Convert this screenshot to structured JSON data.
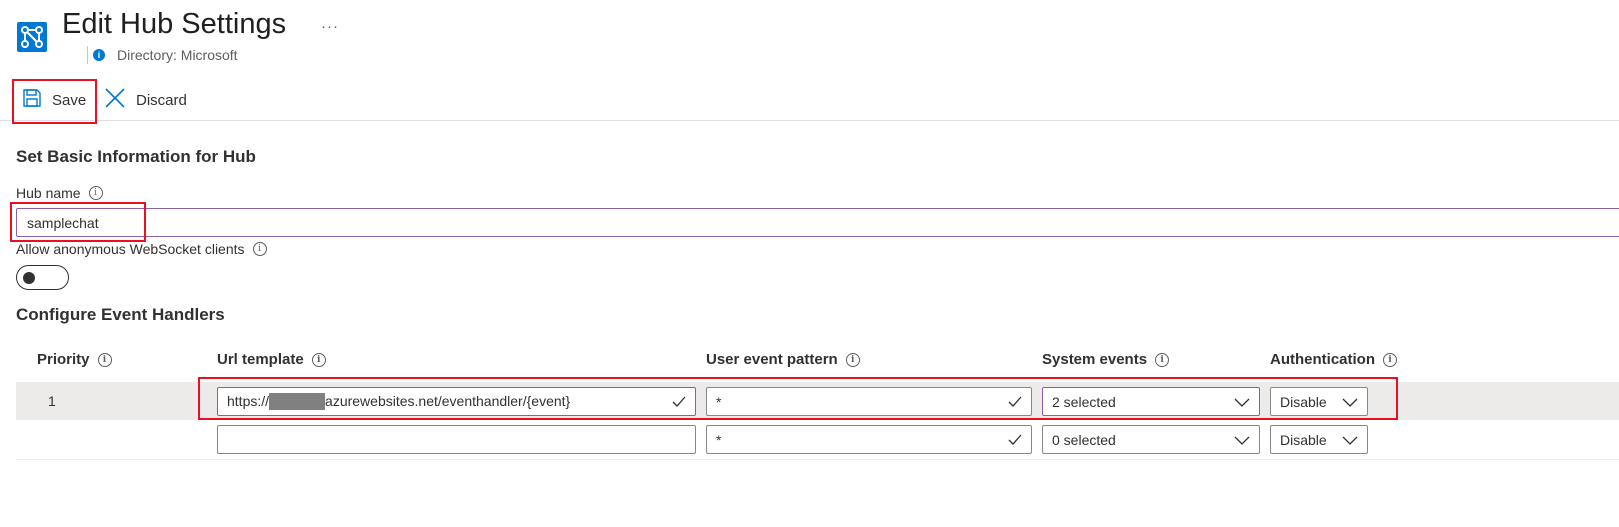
{
  "header": {
    "title": "Edit Hub Settings",
    "more": "···",
    "directory": "Directory: Microsoft"
  },
  "toolbar": {
    "save_label": "Save",
    "discard_label": "Discard"
  },
  "basic": {
    "section_title": "Set Basic Information for Hub",
    "hub_name_label": "Hub name",
    "hub_name_value": "samplechat",
    "anon_label": "Allow anonymous WebSocket clients",
    "anon_enabled": false
  },
  "handlers": {
    "section_title": "Configure Event Handlers",
    "columns": {
      "priority": "Priority",
      "url": "Url template",
      "pattern": "User event pattern",
      "system": "System events",
      "auth": "Authentication"
    },
    "rows": [
      {
        "priority": "1",
        "url_prefix": "https://",
        "url_suffix": "azurewebsites.net/eventhandler/{event}",
        "pattern": "*",
        "system": "2 selected",
        "auth": "Disable"
      },
      {
        "priority": "",
        "url_prefix": "",
        "url_suffix": "",
        "pattern": "*",
        "system": "0 selected",
        "auth": "Disable"
      }
    ]
  },
  "icons": {
    "app": "event-hub-settings-icon",
    "save": "floppy-disk-icon",
    "discard": "close-icon",
    "info": "info-icon",
    "check": "checkmark-icon",
    "chevron": "chevron-down-icon"
  },
  "colors": {
    "accent": "#0078d4",
    "highlight": "#e81123",
    "focus_border": "#8a5fa8"
  }
}
